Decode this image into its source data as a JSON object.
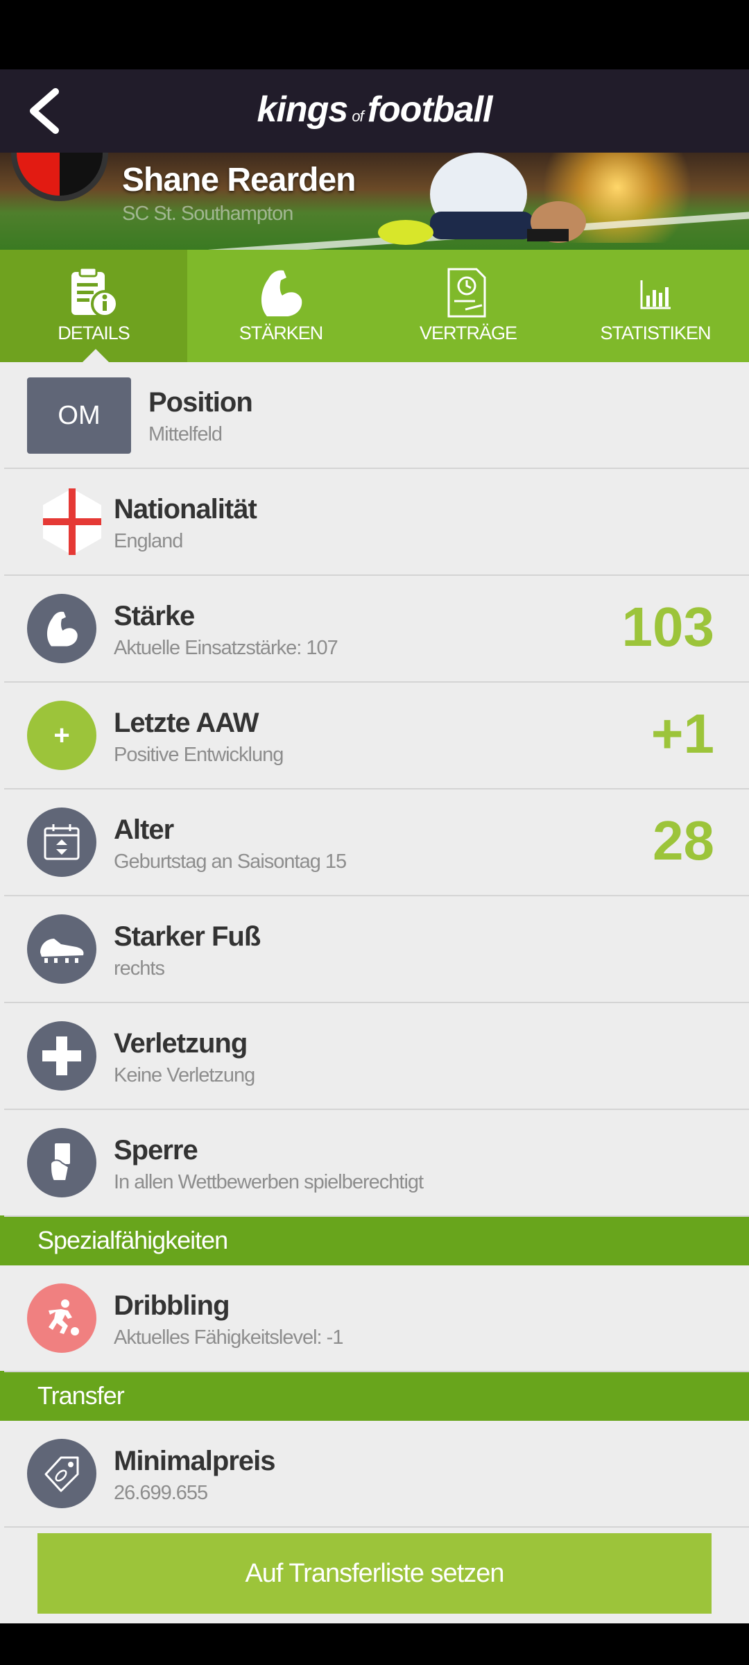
{
  "appbar": {
    "logo_left": "kings",
    "logo_of": "of",
    "logo_right": "football"
  },
  "player": {
    "name": "Shane Rearden",
    "club": "SC St. Southampton"
  },
  "tabs": [
    {
      "label": "DETAILS",
      "icon": "clipboard-info-icon"
    },
    {
      "label": "STÄRKEN",
      "icon": "bicep-icon"
    },
    {
      "label": "VERTRÄGE",
      "icon": "contract-icon"
    },
    {
      "label": "STATISTIKEN",
      "icon": "bar-chart-icon"
    }
  ],
  "details": {
    "position": {
      "badge": "OM",
      "title": "Position",
      "sub": "Mittelfeld"
    },
    "nationality": {
      "title": "Nationalität",
      "sub": "England"
    },
    "strength": {
      "title": "Stärke",
      "sub": "Aktuelle Einsatzstärke: 107",
      "value": "103"
    },
    "last_aaw": {
      "title": "Letzte AAW",
      "sub": "Positive Entwicklung",
      "value": "+1",
      "icon_text": "+"
    },
    "age": {
      "title": "Alter",
      "sub": "Geburtstag an Saisontag 15",
      "value": "28"
    },
    "foot": {
      "title": "Starker Fuß",
      "sub": "rechts"
    },
    "injury": {
      "title": "Verletzung",
      "sub": "Keine Verletzung"
    },
    "suspension": {
      "title": "Sperre",
      "sub": "In allen Wettbewerben spielberechtigt"
    }
  },
  "special_section": {
    "label": "Spezialfähigkeiten"
  },
  "special": {
    "title": "Dribbling",
    "sub": "Aktuelles Fähigkeitslevel: -1"
  },
  "transfer_section": {
    "label": "Transfer"
  },
  "transfer": {
    "title": "Minimalpreis",
    "sub": "26.699.655"
  },
  "cta": {
    "label": "Auf Transferliste setzen"
  },
  "colors": {
    "accent": "#9cc43a",
    "tab_bg": "#7fb92a",
    "section_bg": "#68a51c",
    "icon_bg": "#606677",
    "skill_bg": "#f08080",
    "appbar": "#211c2a"
  }
}
